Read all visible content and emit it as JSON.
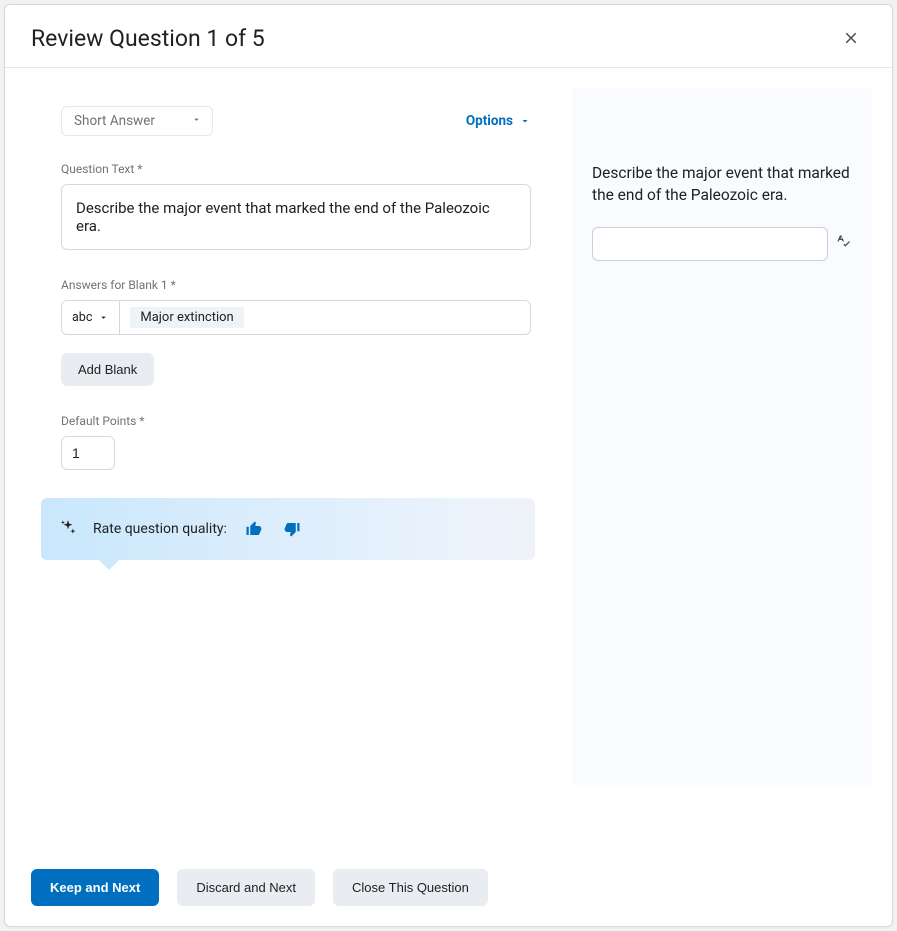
{
  "header": {
    "title": "Review Question 1 of 5"
  },
  "editor": {
    "type_select_label": "Short Answer",
    "options_link": "Options",
    "question_text_label": "Question Text *",
    "question_text_value": "Describe the major event that marked the end of the Paleozoic era.",
    "answers_label": "Answers for Blank 1 *",
    "answers_mode": "abc",
    "answer_tag": "Major extinction",
    "add_blank_label": "Add Blank",
    "default_points_label": "Default Points *",
    "default_points_value": "1"
  },
  "rating": {
    "prompt": "Rate question quality:"
  },
  "preview": {
    "question_text": "Describe the major event that marked the end of the Paleozoic era.",
    "input_value": ""
  },
  "footer": {
    "keep_next": "Keep and Next",
    "discard_next": "Discard and Next",
    "close_question": "Close This Question"
  }
}
